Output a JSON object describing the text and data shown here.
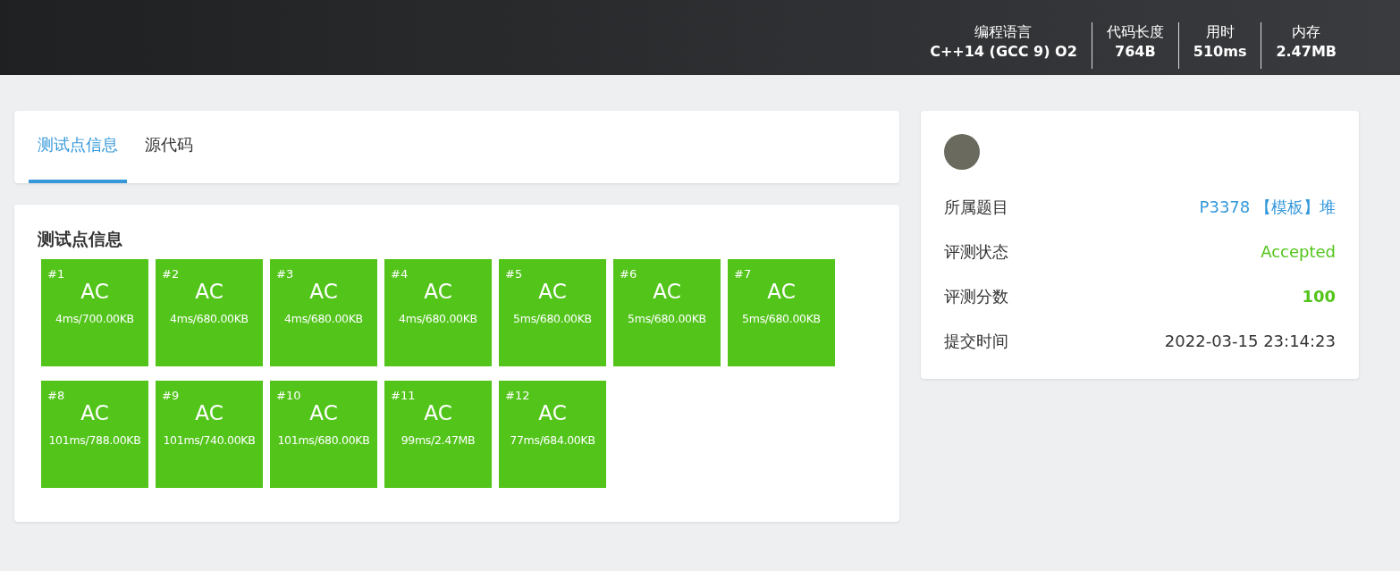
{
  "header_stats": [
    {
      "label": "编程语言",
      "value": "C++14 (GCC 9) O2"
    },
    {
      "label": "代码长度",
      "value": "764B"
    },
    {
      "label": "用时",
      "value": "510ms"
    },
    {
      "label": "内存",
      "value": "2.47MB"
    }
  ],
  "tabs": [
    {
      "label": "测试点信息",
      "selected": true
    },
    {
      "label": "源代码",
      "selected": false
    }
  ],
  "testcases": {
    "title": "测试点信息",
    "cases": [
      {
        "id": "#1",
        "result": "AC",
        "usage": "4ms/700.00KB"
      },
      {
        "id": "#2",
        "result": "AC",
        "usage": "4ms/680.00KB"
      },
      {
        "id": "#3",
        "result": "AC",
        "usage": "4ms/680.00KB"
      },
      {
        "id": "#4",
        "result": "AC",
        "usage": "4ms/680.00KB"
      },
      {
        "id": "#5",
        "result": "AC",
        "usage": "5ms/680.00KB"
      },
      {
        "id": "#6",
        "result": "AC",
        "usage": "5ms/680.00KB"
      },
      {
        "id": "#7",
        "result": "AC",
        "usage": "5ms/680.00KB"
      },
      {
        "id": "#8",
        "result": "AC",
        "usage": "101ms/788.00KB"
      },
      {
        "id": "#9",
        "result": "AC",
        "usage": "101ms/740.00KB"
      },
      {
        "id": "#10",
        "result": "AC",
        "usage": "101ms/680.00KB"
      },
      {
        "id": "#11",
        "result": "AC",
        "usage": "99ms/2.47MB"
      },
      {
        "id": "#12",
        "result": "AC",
        "usage": "77ms/684.00KB"
      }
    ]
  },
  "info": [
    {
      "label": "所属题目",
      "value": "P3378 【模板】堆",
      "kind": "link"
    },
    {
      "label": "评测状态",
      "value": "Accepted",
      "kind": "status"
    },
    {
      "label": "评测分数",
      "value": "100",
      "kind": "score"
    },
    {
      "label": "提交时间",
      "value": "2022-03-15 23:14:23",
      "kind": "text"
    }
  ]
}
